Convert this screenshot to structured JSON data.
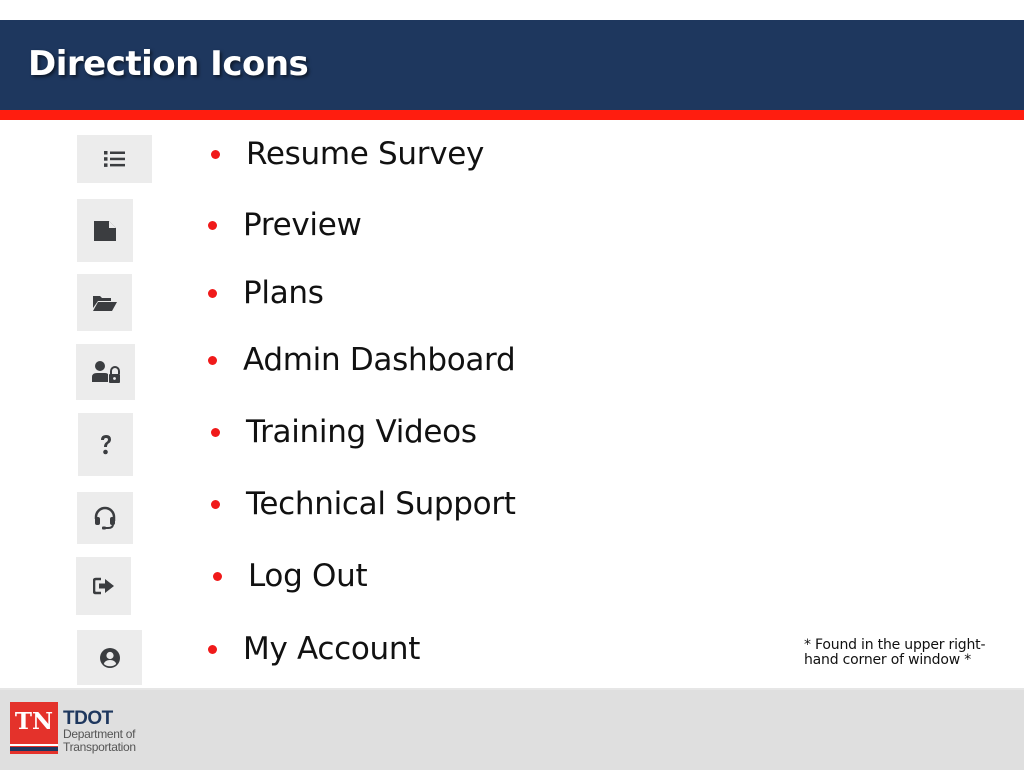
{
  "slide": {
    "title": "Direction Icons",
    "colors": {
      "header_bg": "#1e375e",
      "accent_red": "#ff1d0f",
      "bullet": "#f01a1a",
      "icon_bg": "#ececec",
      "icon_fg": "#3b3d40"
    }
  },
  "items": [
    {
      "icon": "list-icon",
      "label": "Resume Survey"
    },
    {
      "icon": "file-icon",
      "label": "Preview"
    },
    {
      "icon": "folder-open-icon",
      "label": "Plans"
    },
    {
      "icon": "user-lock-icon",
      "label": "Admin Dashboard"
    },
    {
      "icon": "question-icon",
      "label": "Training Videos"
    },
    {
      "icon": "headset-icon",
      "label": "Technical Support"
    },
    {
      "icon": "sign-out-icon",
      "label": "Log Out"
    },
    {
      "icon": "user-circle-icon",
      "label": "My Account"
    }
  ],
  "note": "* Found in the upper right-hand corner of window *",
  "footer": {
    "logo_mark": "TN",
    "brand": "TDOT",
    "dept_line1": "Department of",
    "dept_line2": "Transportation"
  }
}
